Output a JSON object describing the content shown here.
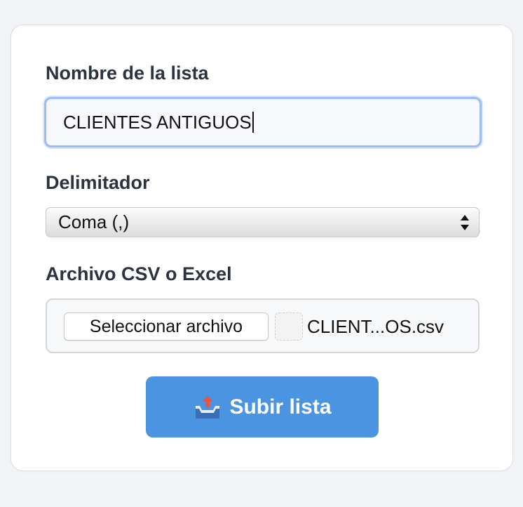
{
  "form": {
    "list_name_label": "Nombre de la lista",
    "list_name_value": "CLIENTES ANTIGUOS",
    "delimiter_label": "Delimitador",
    "delimiter_selected": "Coma (,)",
    "file_label": "Archivo CSV o Excel",
    "file_button_label": "Seleccionar archivo",
    "file_name": "CLIENT...OS.csv",
    "submit_label": "Subir lista",
    "submit_icon": "outbox-tray-icon"
  },
  "colors": {
    "page_bg": "#f1f3f7",
    "card_bg": "#ffffff",
    "focus_border": "#9bbcf5",
    "submit_bg": "#4a94e2",
    "submit_text": "#ffffff",
    "label_text": "#2c3340"
  }
}
